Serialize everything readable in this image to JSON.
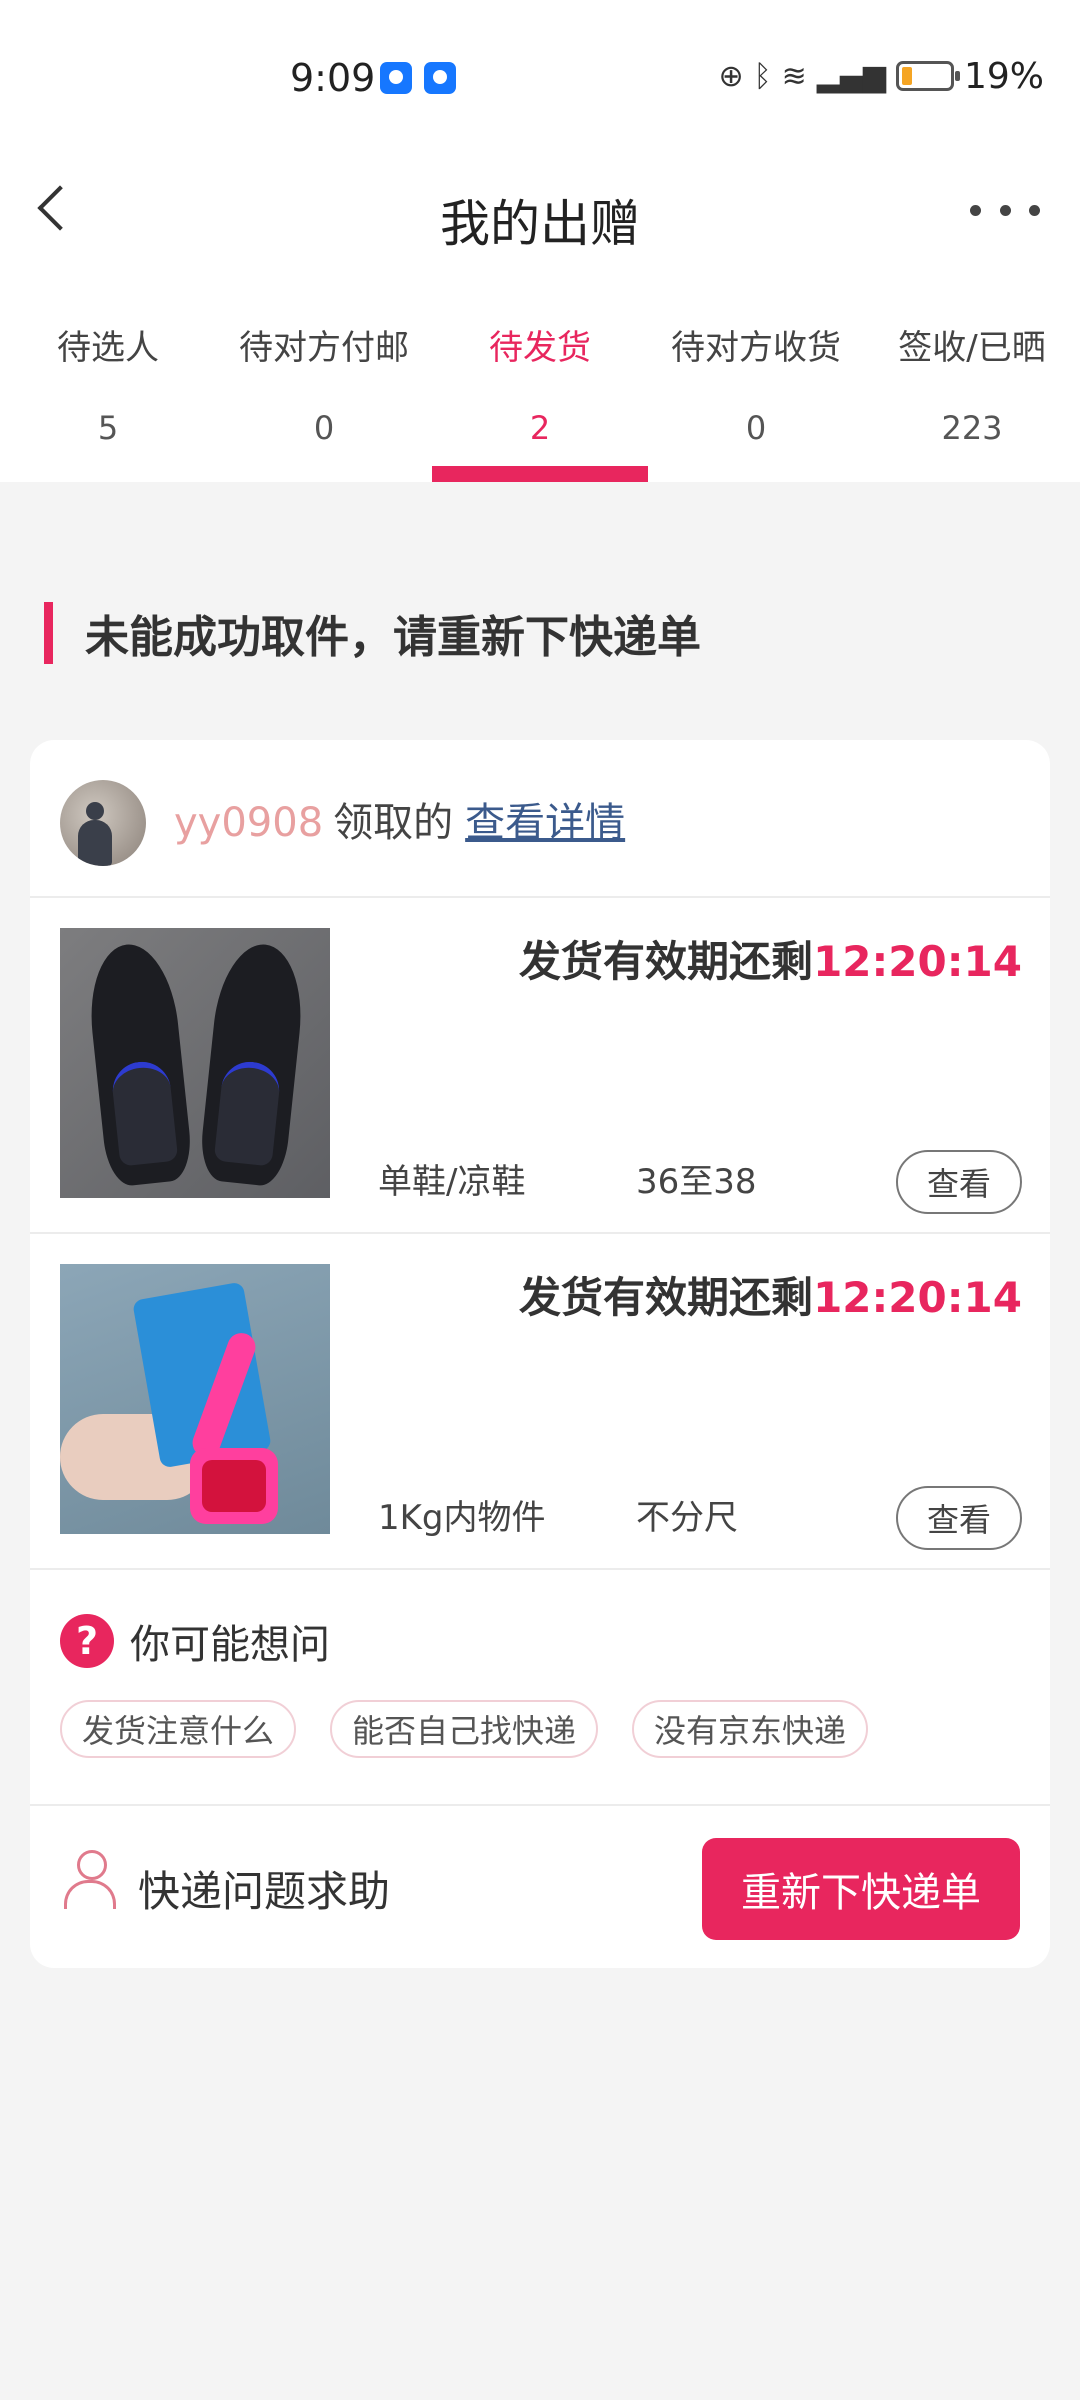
{
  "status_bar": {
    "time": "9:09",
    "battery_percent": "19%",
    "icons": [
      "app-icon",
      "app-icon",
      "data-icon",
      "bluetooth-icon",
      "wifi-icon",
      "signal-icon",
      "battery-icon"
    ]
  },
  "header": {
    "title": "我的出赠",
    "back_icon": "chevron-left-icon",
    "more_icon": "more-dots-icon"
  },
  "tabs": [
    {
      "label": "待选人",
      "count": "5",
      "active": false
    },
    {
      "label": "待对方付邮",
      "count": "0",
      "active": false
    },
    {
      "label": "待发货",
      "count": "2",
      "active": true
    },
    {
      "label": "待对方收货",
      "count": "0",
      "active": false
    },
    {
      "label": "签收/已晒",
      "count": "223",
      "active": false
    }
  ],
  "section": {
    "title": "未能成功取件，请重新下快递单"
  },
  "card": {
    "receiver": {
      "name": "yy0908",
      "action": "领取的",
      "link": "查看详情"
    },
    "items": [
      {
        "deadline_label": "发货有效期还剩",
        "deadline_time": "12:20:14",
        "category": "单鞋/凉鞋",
        "size": "36至38",
        "view_label": "查看"
      },
      {
        "deadline_label": "发货有效期还剩",
        "deadline_time": "12:20:14",
        "category": "1Kg内物件",
        "size": "不分尺",
        "view_label": "查看"
      }
    ],
    "faq": {
      "icon_glyph": "?",
      "title": "你可能想问",
      "chips": [
        "发货注意什么",
        "能否自己找快递",
        "没有京东快递"
      ]
    },
    "help": {
      "label": "快递问题求助",
      "button": "重新下快递单"
    }
  },
  "colors": {
    "accent": "#e8265e",
    "link": "#3b5a8c",
    "receiver_name": "#e8a0a0",
    "background": "#f4f4f4"
  }
}
